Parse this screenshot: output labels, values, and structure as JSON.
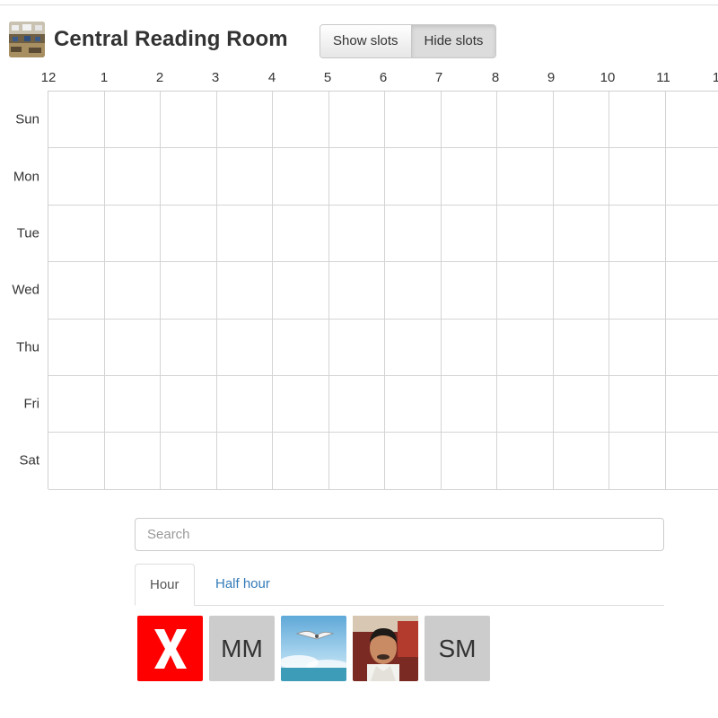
{
  "header": {
    "room_title": "Central Reading Room",
    "show_slots_label": "Show slots",
    "hide_slots_label": "Hide slots",
    "active_toggle": "Hide slots"
  },
  "schedule": {
    "hours": [
      "12",
      "1",
      "2",
      "3",
      "4",
      "5",
      "6",
      "7",
      "8",
      "9",
      "10",
      "11",
      "1"
    ],
    "days": [
      "Sun",
      "Mon",
      "Tue",
      "Wed",
      "Thu",
      "Fri",
      "Sat"
    ]
  },
  "search": {
    "placeholder": "Search",
    "value": ""
  },
  "tabs": {
    "hour_label": "Hour",
    "half_hour_label": "Half hour",
    "active": "Hour"
  },
  "people": {
    "clear_icon": "x-icon",
    "items": [
      {
        "initials": "MM"
      },
      {
        "photo": "seagull-sky-photo"
      },
      {
        "photo": "man-portrait-photo"
      },
      {
        "initials": "SM"
      }
    ]
  },
  "colors": {
    "clear_button": "#ff0000",
    "initials_bg": "#cccccc",
    "link": "#337ab7"
  }
}
